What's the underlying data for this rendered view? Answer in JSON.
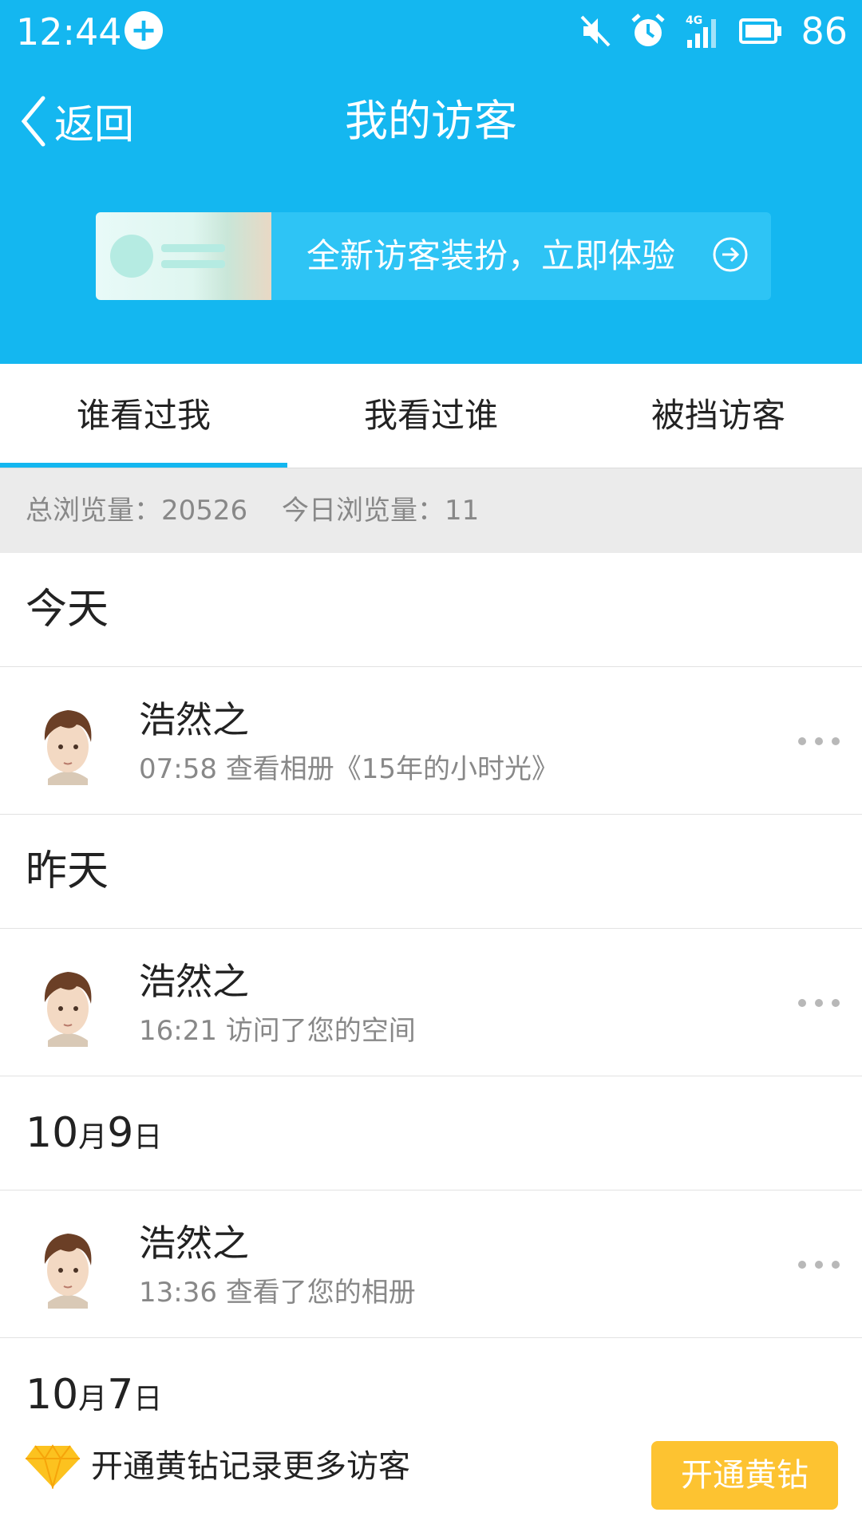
{
  "status_bar": {
    "time": "12:44",
    "battery": "86",
    "icons": [
      "app-sync-icon",
      "mute-icon",
      "alarm-icon",
      "4g-signal-icon",
      "battery-icon"
    ]
  },
  "header": {
    "back_label": "返回",
    "title": "我的访客"
  },
  "promo": {
    "text": "全新访客装扮，立即体验"
  },
  "tabs": [
    {
      "label": "谁看过我",
      "active": true
    },
    {
      "label": "我看过谁",
      "active": false
    },
    {
      "label": "被挡访客",
      "active": false
    }
  ],
  "stats": {
    "total": "总浏览量：20526",
    "today": "今日浏览量：11"
  },
  "sections": [
    {
      "title": "今天",
      "visitor": {
        "name": "浩然之",
        "desc": "07:58 查看相册《15年的小时光》"
      }
    },
    {
      "title": "昨天",
      "visitor": {
        "name": "浩然之",
        "desc": "16:21 访问了您的空间"
      }
    },
    {
      "title_num1": "10",
      "title_unit1": "月",
      "title_num2": "9",
      "title_unit2": "日",
      "visitor": {
        "name": "浩然之",
        "desc": "13:36 查看了您的相册"
      }
    },
    {
      "title_num1": "10",
      "title_unit1": "月",
      "title_num2": "7",
      "title_unit2": "日"
    }
  ],
  "vip_bar": {
    "text": "开通黄钻记录更多访客",
    "button": "开通黄钻"
  },
  "colors": {
    "accent": "#14b7f0",
    "vip_button": "#fdc331"
  }
}
